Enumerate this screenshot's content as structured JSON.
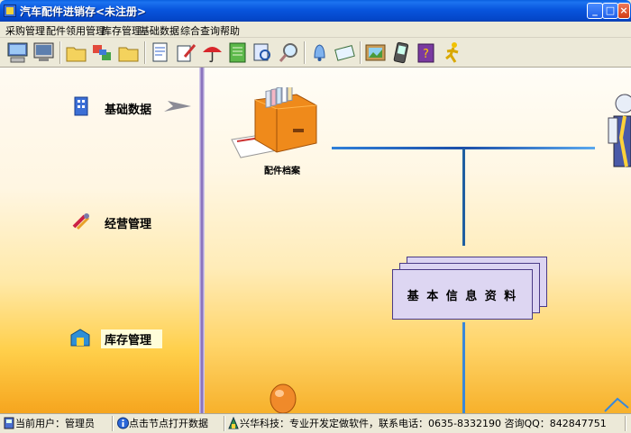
{
  "window": {
    "title": "汽车配件进销存<未注册>"
  },
  "menu": {
    "items": [
      "采购管理",
      "配件领用管理",
      "库存管理",
      "基础数据",
      "综合查询",
      "帮助"
    ]
  },
  "toolbar": {
    "buttons": [
      "computer-icon",
      "monitor-icon",
      "folder-icon",
      "swap-icon",
      "folder-icon",
      "document-icon",
      "edit-icon",
      "umbrella-icon",
      "notebook-icon",
      "search-doc-icon",
      "magnifier-icon",
      "bell-icon",
      "envelope-icon",
      "picture-icon",
      "pda-icon",
      "help-book-icon",
      "runner-icon"
    ]
  },
  "nav": {
    "items": [
      {
        "label": "基础数据",
        "icon": "building-icon"
      },
      {
        "label": "经营管理",
        "icon": "tools-icon"
      },
      {
        "label": "库存管理",
        "icon": "warehouse-icon"
      }
    ],
    "selected": 2
  },
  "content": {
    "archive_label": "配件档案",
    "info_box": "基 本 信 息 资 料"
  },
  "status": {
    "user": "当前用户：管理员",
    "hint": "点击节点打开数据",
    "company": "兴华科技：专业开发定做软件，联系电话：0635-8332190 咨询QQ：842847751"
  },
  "colors": {
    "title_bar": "#0855dd",
    "accent_line": "#2f7fd8",
    "panel_gradient_end": "#f6a51e"
  }
}
